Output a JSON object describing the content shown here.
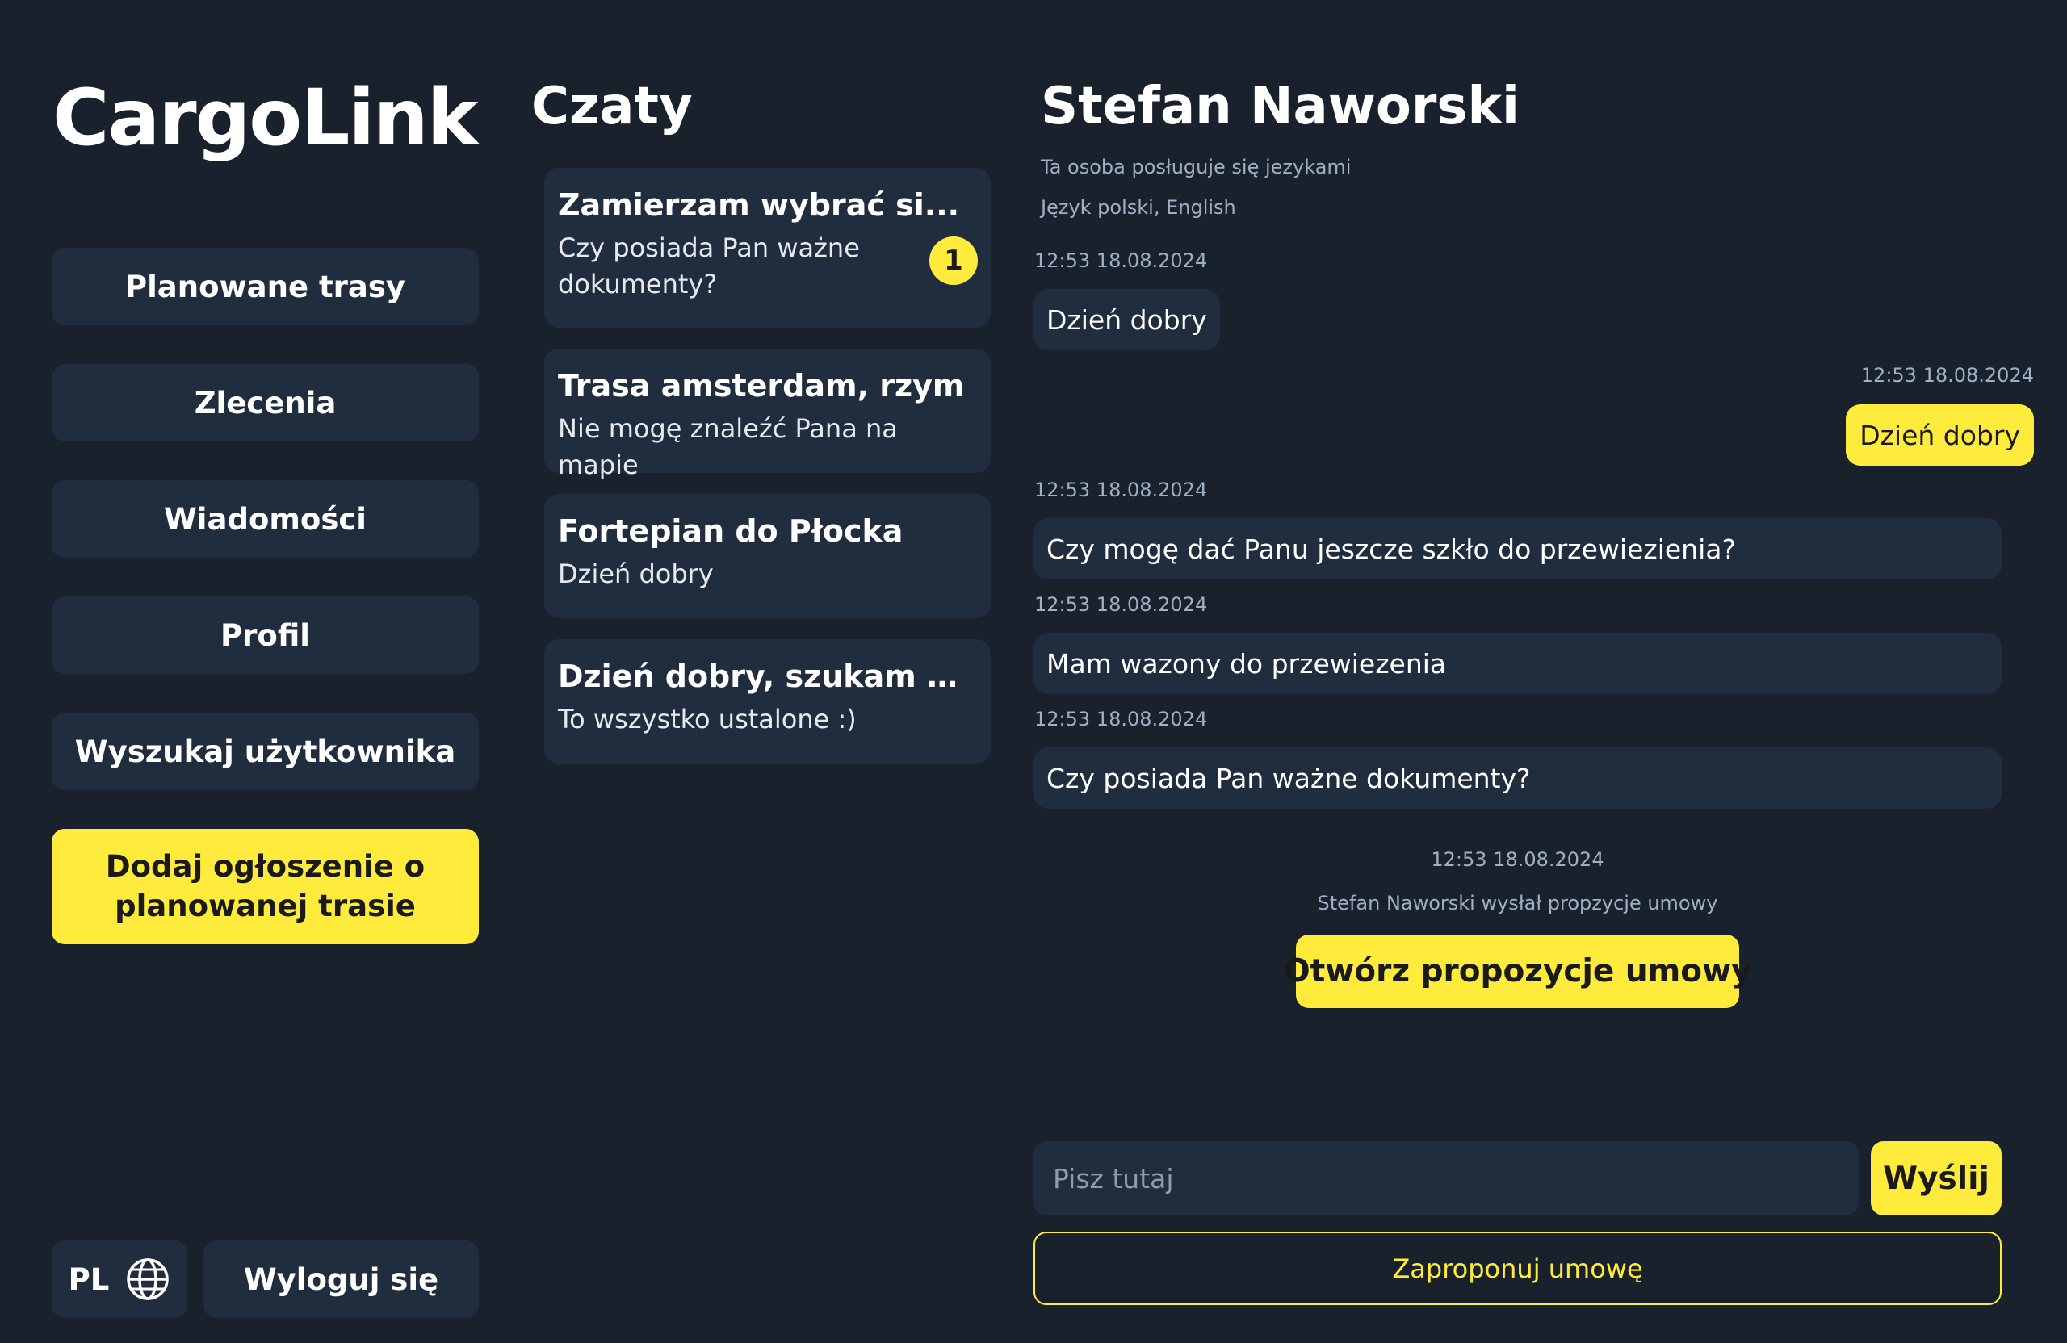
{
  "app": {
    "title": "CargoLink"
  },
  "sidebar": {
    "items": [
      {
        "label": "Planowane trasy"
      },
      {
        "label": "Zlecenia"
      },
      {
        "label": "Wiadomości"
      },
      {
        "label": "Profil"
      },
      {
        "label": "Wyszukaj użytkownika"
      }
    ],
    "primary_action": "Dodaj ogłoszenie o planowanej trasie",
    "language": "PL",
    "language_icon": "globe-icon",
    "logout": "Wyloguj się"
  },
  "chats": {
    "title": "Czaty",
    "items": [
      {
        "title": "Zamierzam wybrać si...",
        "preview": "Czy posiada Pan ważne dokumenty?",
        "unread": "1"
      },
      {
        "title": "Trasa amsterdam, rzym",
        "preview": "Nie mogę znaleźć Pana na mapie"
      },
      {
        "title": "Fortepian do Płocka",
        "preview": "Dzień dobry"
      },
      {
        "title": "Dzień dobry, szukam osob...",
        "preview": "To wszystko ustalone :)"
      }
    ]
  },
  "conversation": {
    "name": "Stefan Naworski",
    "languages_label": "Ta osoba posługuje się jezykami",
    "languages": "Język polski, English",
    "messages": [
      {
        "time": "12:53 18.08.2024",
        "text": "Dzień dobry",
        "direction": "in"
      },
      {
        "time": "12:53 18.08.2024",
        "text": "Dzień dobry",
        "direction": "out"
      },
      {
        "time": "12:53 18.08.2024",
        "text": "Czy mogę dać Panu jeszcze szkło do przewiezienia?",
        "direction": "in"
      },
      {
        "time": "12:53 18.08.2024",
        "text": "Mam wazony do przewiezenia",
        "direction": "in"
      },
      {
        "time": "12:53 18.08.2024",
        "text": "Czy posiada Pan ważne dokumenty?",
        "direction": "in"
      }
    ],
    "proposal": {
      "time": "12:53 18.08.2024",
      "text": "Stefan Naworski wysłał propzycje umowy",
      "button": "Otwórz propozycje umowy"
    },
    "input": {
      "placeholder": "Pisz tutaj",
      "value": ""
    },
    "send": "Wyślij",
    "propose_contract": "Zaproponuj umowę"
  },
  "colors": {
    "background": "#18212c",
    "panel": "#1f2d3e",
    "accent": "#ffeb3b",
    "muted_text": "#9fb0c4"
  }
}
